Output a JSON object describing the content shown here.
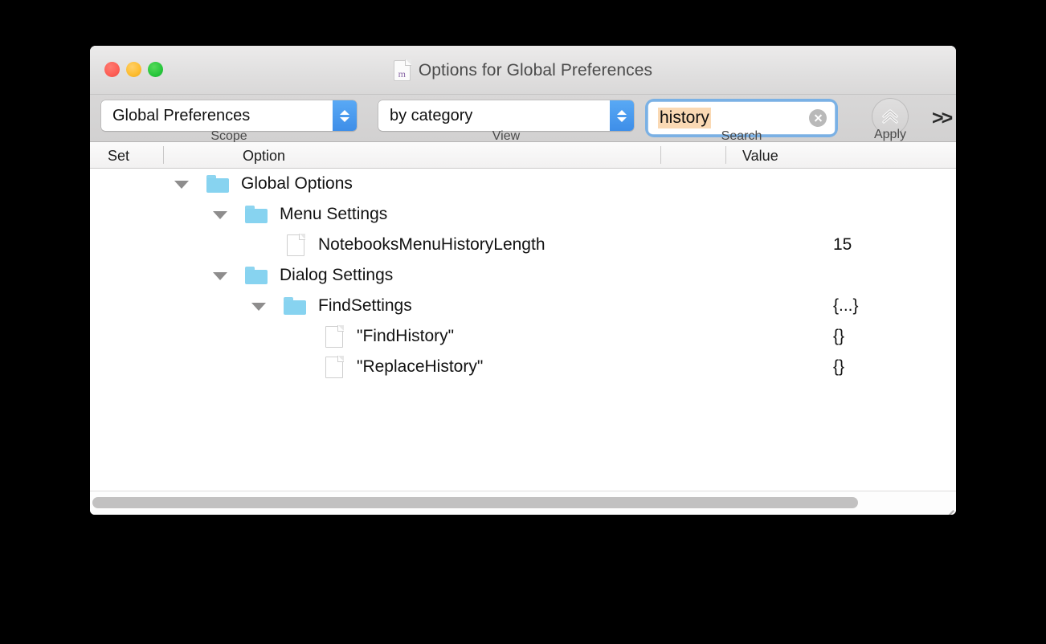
{
  "window": {
    "title": "Options for Global Preferences",
    "doc_icon_letter": "m",
    "traffic_lights": [
      {
        "name": "close",
        "color": "#fd5e55"
      },
      {
        "name": "minimize",
        "color": "#fdbc2e"
      },
      {
        "name": "zoom",
        "color": "#27c63b"
      }
    ]
  },
  "toolbar": {
    "scope": {
      "value": "Global Preferences",
      "label": "Scope"
    },
    "view": {
      "value": "by category",
      "label": "View"
    },
    "search": {
      "value": "history",
      "placeholder": "Search",
      "label": "Search",
      "highlight_color": "#fad9b4",
      "clear_icon": "clear-icon"
    },
    "apply": {
      "label": "Apply",
      "icon": "double-chevron-up-icon"
    },
    "overflow": ">>"
  },
  "columns": {
    "set": "Set",
    "option": "Option",
    "value": "Value"
  },
  "tree": {
    "rows": [
      {
        "label": "Global Options",
        "value": "",
        "icon": "folder-icon",
        "depth": 0,
        "disclosure": "expanded"
      },
      {
        "label": "Menu Settings",
        "value": "",
        "icon": "folder-icon",
        "depth": 1,
        "disclosure": "expanded"
      },
      {
        "label": "NotebooksMenuHistoryLength",
        "value": "15",
        "icon": "file-icon",
        "depth": 2,
        "disclosure": "none"
      },
      {
        "label": "Dialog Settings",
        "value": "",
        "icon": "folder-icon",
        "depth": 1,
        "disclosure": "expanded"
      },
      {
        "label": "FindSettings",
        "value": "{...}",
        "icon": "folder-icon",
        "depth": 2,
        "disclosure": "expanded"
      },
      {
        "label": "\"FindHistory\"",
        "value": "{}",
        "icon": "file-icon",
        "depth": 3,
        "disclosure": "none"
      },
      {
        "label": "\"ReplaceHistory\"",
        "value": "{}",
        "icon": "file-icon",
        "depth": 3,
        "disclosure": "none"
      }
    ]
  }
}
